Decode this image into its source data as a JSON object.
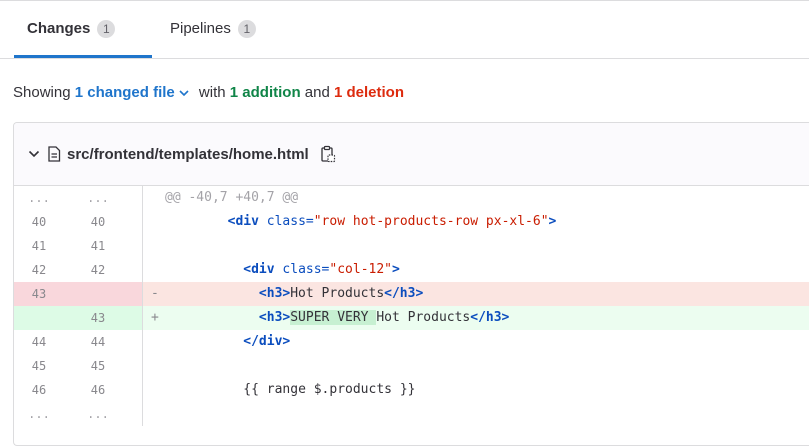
{
  "tabs": [
    {
      "label": "Changes",
      "count": "1"
    },
    {
      "label": "Pipelines",
      "count": "1"
    }
  ],
  "summary": {
    "prefix": "Showing",
    "changed_files": "1 changed file",
    "with": "with",
    "additions": "1 addition",
    "and": "and",
    "deletions": "1 deletion"
  },
  "file": {
    "path": "src/frontend/templates/home.html"
  },
  "diff": {
    "hunk_header": "@@ -40,7 +40,7 @@",
    "ellipsis": "...",
    "lines": [
      {
        "old": "40",
        "new": "40",
        "indent": "        ",
        "pre": "<div ",
        "attr": "class=",
        "str": "\"row hot-products-row px-xl-6\"",
        "post": ">"
      },
      {
        "old": "41",
        "new": "41"
      },
      {
        "old": "42",
        "new": "42",
        "indent": "          ",
        "pre": "<div ",
        "attr": "class=",
        "str": "\"col-12\"",
        "post": ">"
      },
      {
        "old": "43",
        "new": "",
        "marker": "-",
        "indent": "            ",
        "open": "<h3>",
        "text": "Hot Products",
        "close": "</h3>"
      },
      {
        "old": "",
        "new": "43",
        "marker": "+",
        "indent": "            ",
        "open": "<h3>",
        "hl": "SUPER VERY ",
        "text": "Hot Products",
        "close": "</h3>"
      },
      {
        "old": "44",
        "new": "44",
        "indent": "          ",
        "close": "</div>"
      },
      {
        "old": "45",
        "new": "45"
      },
      {
        "old": "46",
        "new": "46",
        "indent": "          ",
        "plain": "{{ range $.products }}"
      }
    ]
  }
}
